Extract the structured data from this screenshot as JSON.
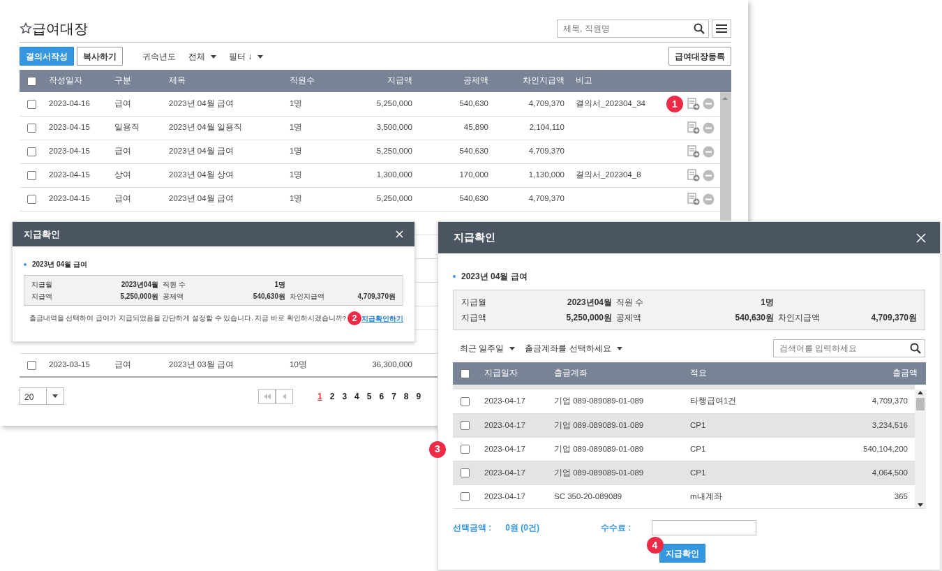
{
  "page": {
    "title": "급여대장",
    "search": {
      "placeholder": "제목, 직원명"
    },
    "toolbar": {
      "buttons": [
        {
          "label": "결의서작성",
          "kind": "primary"
        },
        {
          "label": "복사하기",
          "kind": "outline"
        }
      ],
      "filters": [
        {
          "label": "귀속년도",
          "kind": "label"
        },
        {
          "label": "전체",
          "kind": "dropdown"
        },
        {
          "label": "필터 ↓",
          "kind": "dropdown"
        }
      ],
      "register_button": "급여대장등록"
    },
    "table": {
      "select_all": {
        "checked": false
      },
      "columns": [
        "작성일자",
        "구분",
        "제목",
        "직원수",
        "지급액",
        "공제액",
        "차인지급액",
        "비고"
      ],
      "rows": [
        {
          "checked": false,
          "cells": [
            "2023-04-16",
            "급여",
            "2023년 04월 급여",
            "1명",
            "5,250,000",
            "540,630",
            "4,709,370",
            "결의서_202304_34"
          ],
          "callout": "1"
        },
        {
          "checked": false,
          "cells": [
            "2023-04-15",
            "일용직",
            "2023년 04월 일용직",
            "1명",
            "3,500,000",
            "45,890",
            "2,104,110",
            ""
          ]
        },
        {
          "checked": false,
          "cells": [
            "2023-04-15",
            "급여",
            "2023년 04월 급여",
            "1명",
            "5,250,000",
            "540,630",
            "4,709,370",
            ""
          ]
        },
        {
          "checked": false,
          "cells": [
            "2023-04-15",
            "상여",
            "2023년 04월 상여",
            "1명",
            "1,300,000",
            "170,000",
            "1,130,000",
            "결의서_202304_8"
          ]
        },
        {
          "checked": false,
          "cells": [
            "2023-04-15",
            "급여",
            "2023년 04월 급여",
            "1명",
            "5,250,000",
            "540,630",
            "4,709,370",
            ""
          ]
        }
      ],
      "last_row": {
        "checked": false,
        "cells": [
          "2023-03-15",
          "급여",
          "2023년 03월 급여",
          "10명",
          "36,300,000"
        ]
      }
    },
    "pagination": {
      "page_size": "20",
      "pages": [
        {
          "label": "1",
          "selected": true
        },
        {
          "label": "2",
          "selected": false
        },
        {
          "label": "3",
          "selected": false
        },
        {
          "label": "4",
          "selected": false
        },
        {
          "label": "5",
          "selected": false
        },
        {
          "label": "6",
          "selected": false
        },
        {
          "label": "7",
          "selected": false
        },
        {
          "label": "8",
          "selected": false
        },
        {
          "label": "9",
          "selected": false
        }
      ]
    }
  },
  "small_dialog": {
    "title": "지급확인",
    "subtitle": "2023년 04월 급여",
    "info": [
      [
        {
          "label": "지급월",
          "value": "2023년04월"
        },
        {
          "label": "직원 수",
          "value": "1명"
        }
      ],
      [
        {
          "label": "지급액",
          "value": "5,250,000원"
        },
        {
          "label": "공제액",
          "value": "540,630원"
        },
        {
          "label": "차인지급액",
          "value": "4,709,370원"
        }
      ]
    ],
    "message": "출금내역을 선택하여 급여가 지급되었음을 간단하게 설정할 수 있습니다. 지금 바로 확인하시겠습니까?",
    "callout": "2",
    "link": "지급확인하기"
  },
  "large_dialog": {
    "title": "지급확인",
    "subtitle": "2023년 04월 급여",
    "info": [
      [
        {
          "label": "지급월",
          "value": "2023년04월"
        },
        {
          "label": "직원 수",
          "value": "1명"
        }
      ],
      [
        {
          "label": "지급액",
          "value": "5,250,000원"
        },
        {
          "label": "공제액",
          "value": "540,630원"
        },
        {
          "label": "차인지급액",
          "value": "4,709,370원"
        }
      ]
    ],
    "filters": [
      "최근 일주일",
      "출금계좌를 선택하세요"
    ],
    "search": {
      "placeholder": "검색어를 입력하세요"
    },
    "table": {
      "select_all": {
        "checked": false
      },
      "columns": [
        "지급일자",
        "출금계좌",
        "적요",
        "출금액"
      ],
      "callout": "3",
      "rows": [
        {
          "checked": false,
          "cells": [
            "2023-04-17",
            "기업 089-089089-01-089",
            "타행급여1건",
            "4,709,370"
          ]
        },
        {
          "checked": false,
          "cells": [
            "2023-04-17",
            "기업 089-089089-01-089",
            "CP1",
            "3,234,516"
          ]
        },
        {
          "checked": false,
          "cells": [
            "2023-04-17",
            "기업 089-089089-01-089",
            "CP1",
            "540,104,200"
          ]
        },
        {
          "checked": false,
          "cells": [
            "2023-04-17",
            "기업 089-089089-01-089",
            "CP1",
            "4,064,500"
          ]
        },
        {
          "checked": false,
          "cells": [
            "2023-04-17",
            "SC 350-20-089089",
            "m내계좌",
            "365"
          ]
        }
      ]
    },
    "summary": {
      "label": "선택금액 :",
      "value": "0원 (0건)"
    },
    "fee": {
      "label": "수수료 :"
    },
    "button": {
      "label": "지급확인",
      "callout": "4"
    }
  }
}
